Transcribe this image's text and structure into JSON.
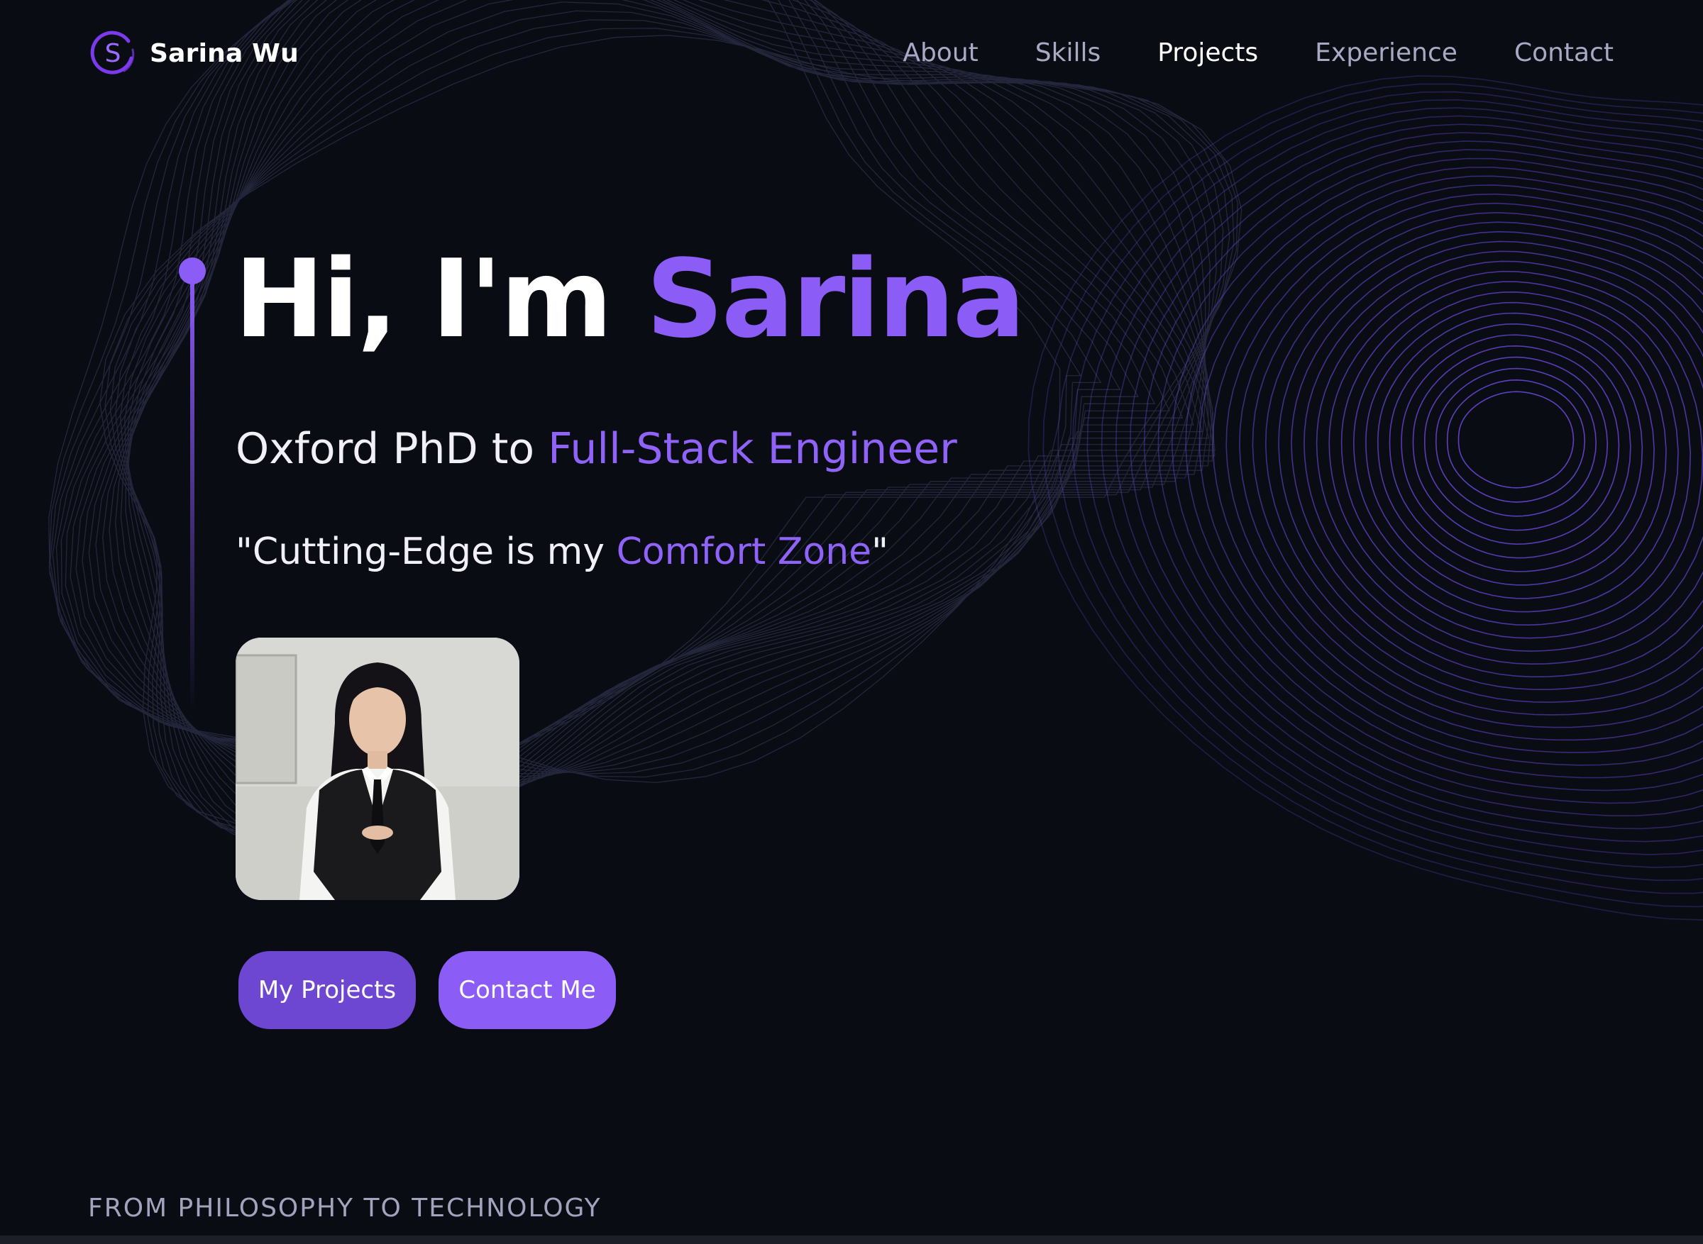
{
  "brand": {
    "logo_letter": "S",
    "name": "Sarina Wu"
  },
  "nav": {
    "items": [
      {
        "label": "About",
        "active": false
      },
      {
        "label": "Skills",
        "active": false
      },
      {
        "label": "Projects",
        "active": true
      },
      {
        "label": "Experience",
        "active": false
      },
      {
        "label": "Contact",
        "active": false
      }
    ]
  },
  "hero": {
    "greeting": "Hi, I'm ",
    "name": "Sarina",
    "subtitle_prefix": "Oxford PhD to ",
    "subtitle_highlight": "Full-Stack Engineer",
    "quote_prefix": "\"Cutting-Edge is my ",
    "quote_highlight": "Comfort Zone",
    "quote_suffix": "\""
  },
  "buttons": {
    "projects": "My Projects",
    "contact": "Contact Me"
  },
  "section": {
    "label": "FROM PHILOSOPHY TO TECHNOLOGY"
  },
  "colors": {
    "background": "#0a0c14",
    "accent": "#8b5cf6",
    "accent_dark": "#6d46d1",
    "nav_text": "#a9a9c4",
    "wave": "#6d4ae0"
  },
  "icons": {
    "brand": "logo-s-circle-icon",
    "timeline": "timeline-dot-icon"
  }
}
